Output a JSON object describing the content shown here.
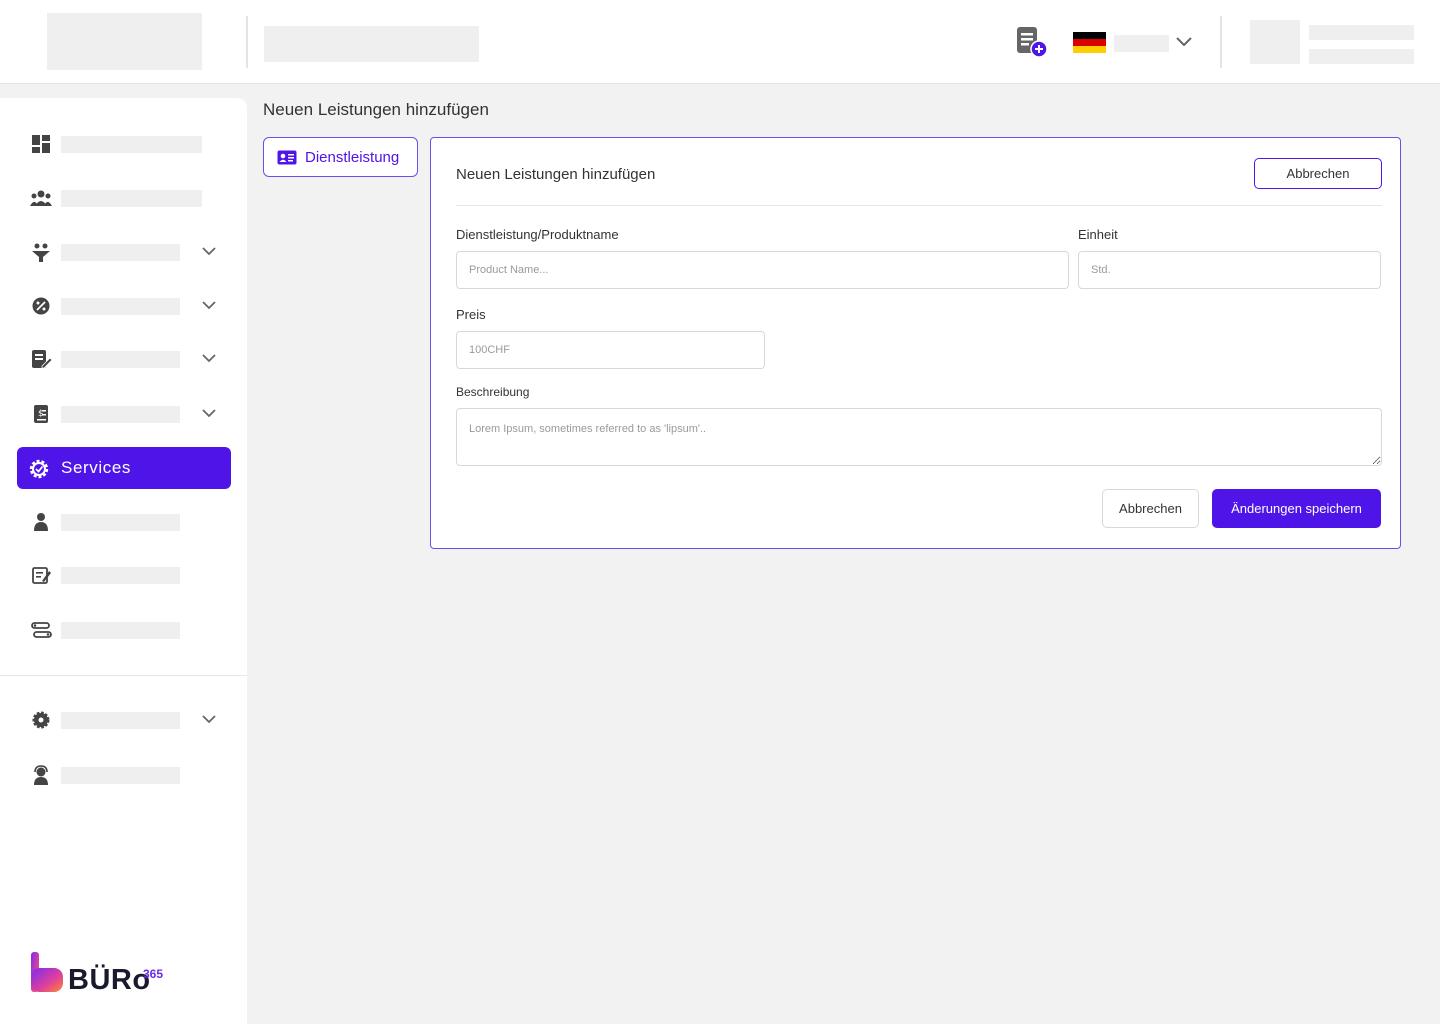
{
  "header": {
    "language_flag": "de-flag-icon",
    "add_document_icon": "add-document-icon"
  },
  "sidebar": {
    "items": [
      {
        "icon": "dashboard-icon",
        "has_chevron": false
      },
      {
        "icon": "team-icon",
        "has_chevron": false
      },
      {
        "icon": "funnel-icon",
        "has_chevron": true
      },
      {
        "icon": "discount-icon",
        "has_chevron": true
      },
      {
        "icon": "edit-document-icon",
        "has_chevron": true
      },
      {
        "icon": "invoice-icon",
        "has_chevron": true
      },
      {
        "icon": "service-gear-icon",
        "label": "Services",
        "active": true
      },
      {
        "icon": "person-icon",
        "has_chevron": false
      },
      {
        "icon": "notes-icon",
        "has_chevron": false
      },
      {
        "icon": "route-icon",
        "has_chevron": false
      },
      {
        "icon": "settings-icon",
        "has_chevron": true
      },
      {
        "icon": "support-icon",
        "has_chevron": false
      }
    ],
    "active_label": "Services",
    "logo_text": "BÜRo",
    "logo_sup": "365"
  },
  "main": {
    "page_title": "Neuen Leistungen hinzufügen",
    "tab_label": "Dienstleistung",
    "card": {
      "title": "Neuen Leistungen hinzufügen",
      "top_cancel": "Abbrechen",
      "fields": {
        "name_label": "Dienstleistung/Produktname",
        "name_placeholder": "Product Name...",
        "unit_label": "Einheit",
        "unit_placeholder": "Std.",
        "price_label": "Preis",
        "price_placeholder": "100CHF",
        "desc_label": "Beschreibung",
        "desc_placeholder": "Lorem Ipsum, sometimes referred to as 'lipsum'.."
      },
      "cancel_label": "Abbrechen",
      "save_label": "Änderungen speichern"
    }
  },
  "colors": {
    "accent": "#4f15e8",
    "border_accent": "#6a50e8",
    "placeholder_gray": "#efefef"
  }
}
